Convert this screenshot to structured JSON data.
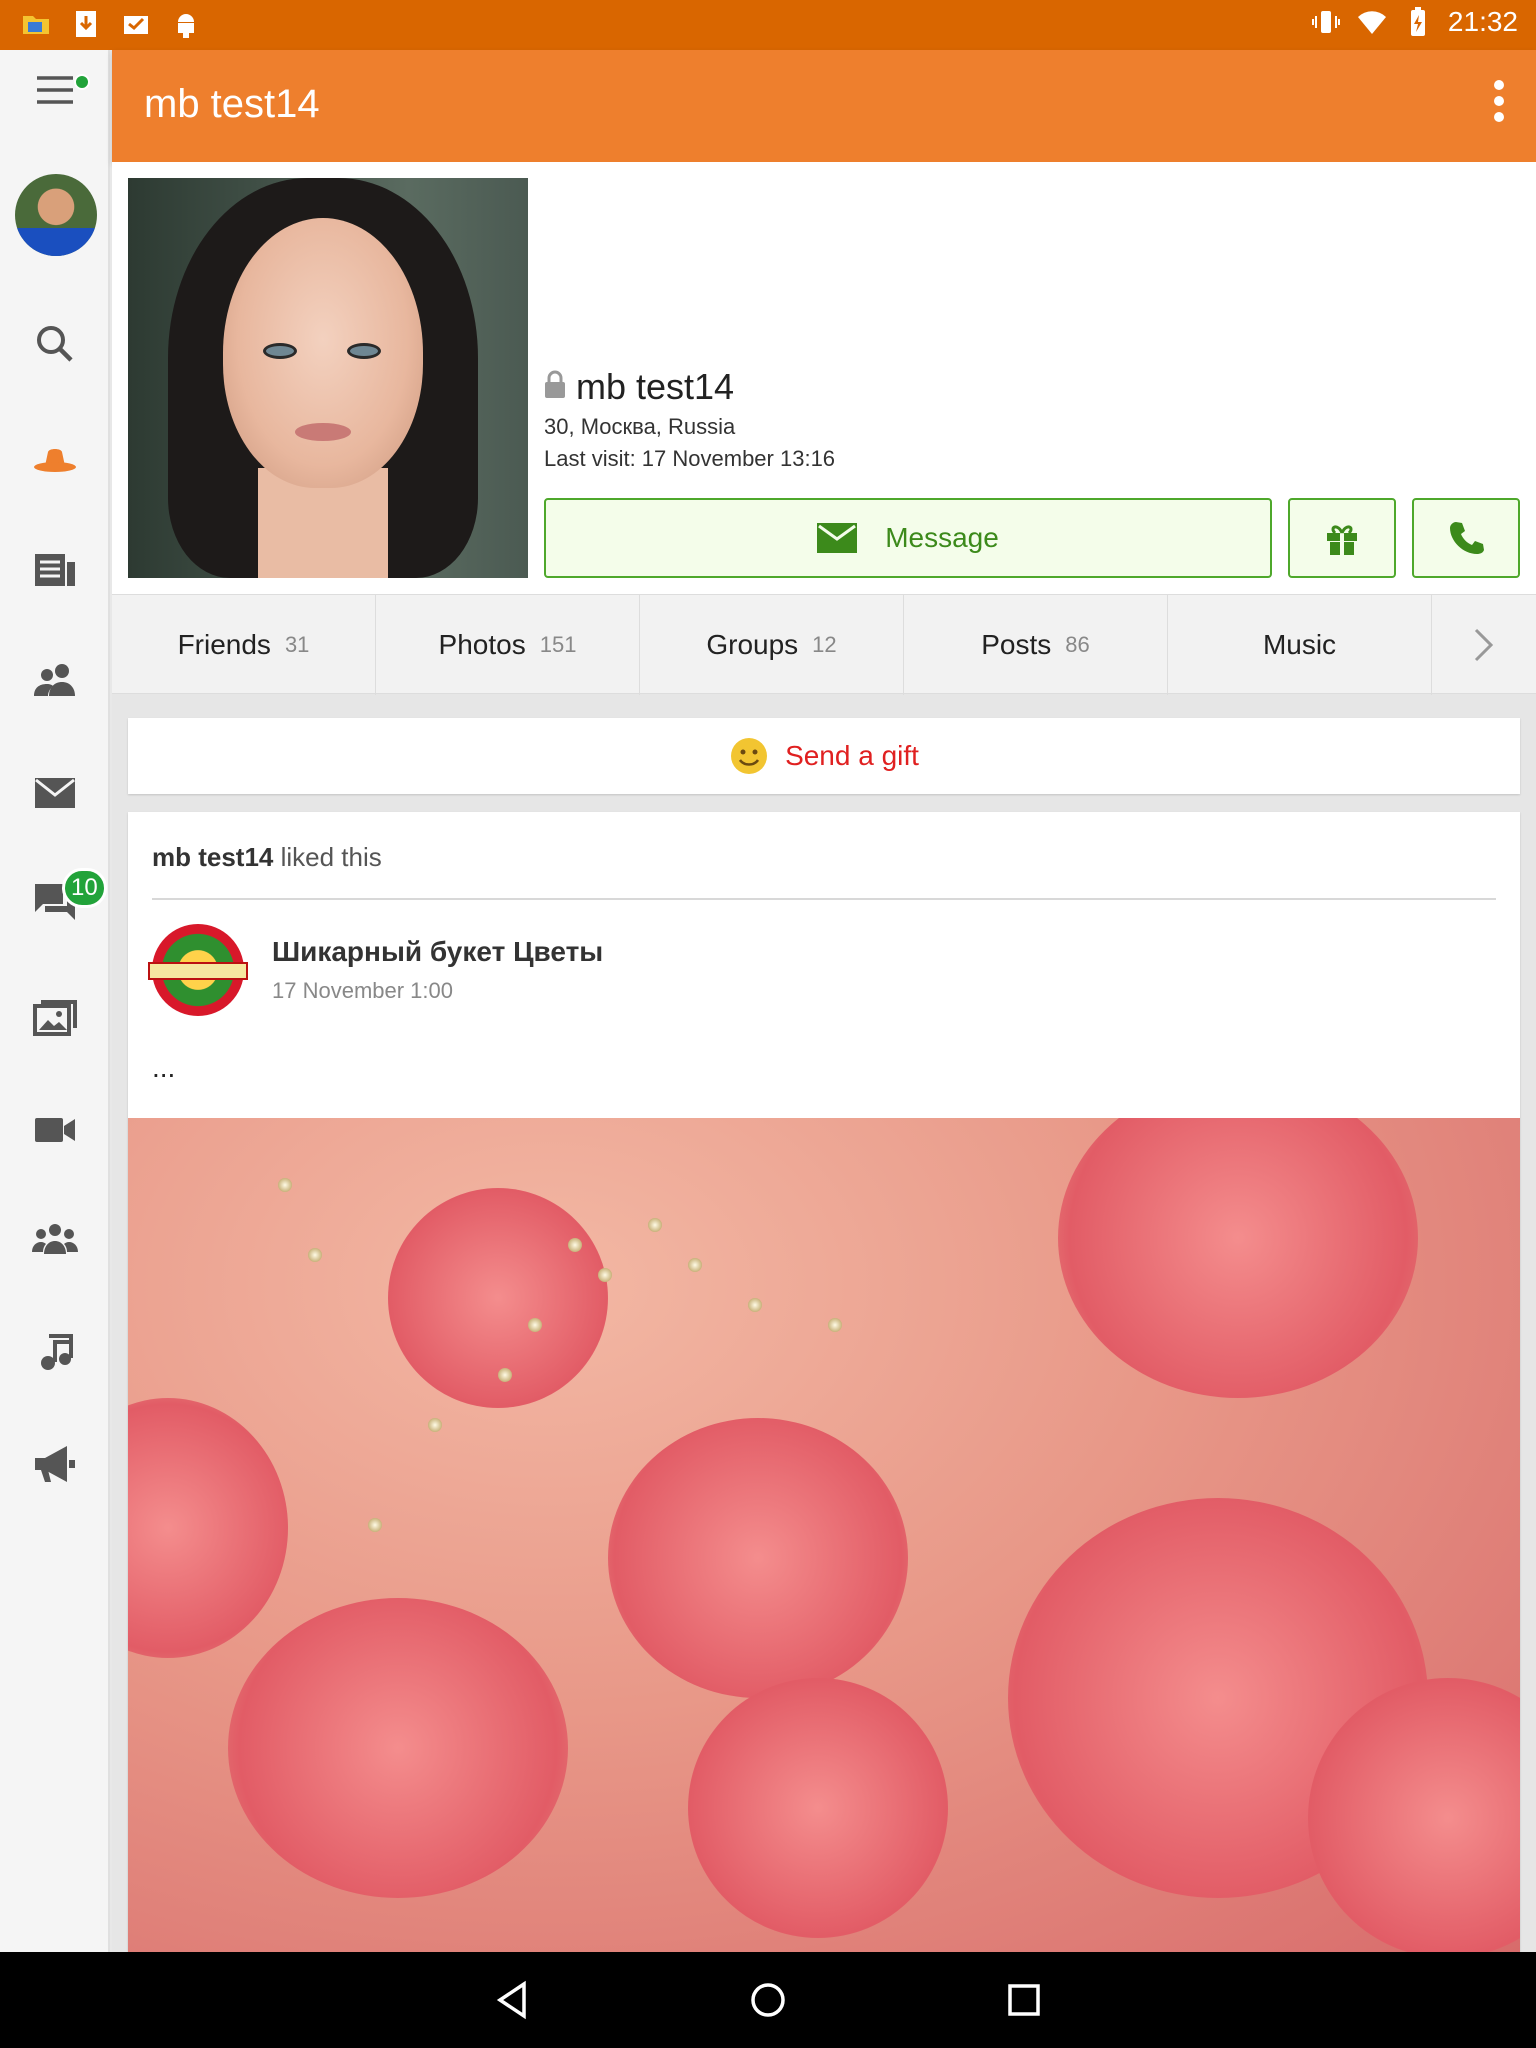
{
  "status_bar": {
    "time": "21:32"
  },
  "colors": {
    "accent": "#ee7f2d",
    "status_bar": "#d96600",
    "green": "#4ea82b",
    "gift_red": "#e02020"
  },
  "rail": {
    "items": [
      {
        "icon": "menu-icon"
      },
      {
        "icon": "avatar"
      },
      {
        "icon": "search-icon"
      },
      {
        "icon": "guests-hat-icon"
      },
      {
        "icon": "news-feed-icon"
      },
      {
        "icon": "friends-icon"
      },
      {
        "icon": "mail-icon"
      },
      {
        "icon": "discussions-icon",
        "badge": "10"
      },
      {
        "icon": "photos-icon"
      },
      {
        "icon": "video-icon"
      },
      {
        "icon": "groups-icon"
      },
      {
        "icon": "music-icon"
      },
      {
        "icon": "megaphone-icon"
      }
    ]
  },
  "appbar": {
    "title": "mb test14"
  },
  "profile": {
    "name": "mb test14",
    "location": "30, Москва, Russia",
    "last_visit": "Last visit: 17 November 13:16",
    "message_label": "Message"
  },
  "tabs": [
    {
      "label": "Friends",
      "count": "31"
    },
    {
      "label": "Photos",
      "count": "151"
    },
    {
      "label": "Groups",
      "count": "12"
    },
    {
      "label": "Posts",
      "count": "86"
    },
    {
      "label": "Music",
      "count": ""
    }
  ],
  "gift": {
    "label": "Send a gift"
  },
  "post": {
    "author": "mb test14",
    "action": " liked this",
    "group_name": "Шикарный букет Цветы",
    "group_date": "17 November 1:00",
    "text": "..."
  }
}
